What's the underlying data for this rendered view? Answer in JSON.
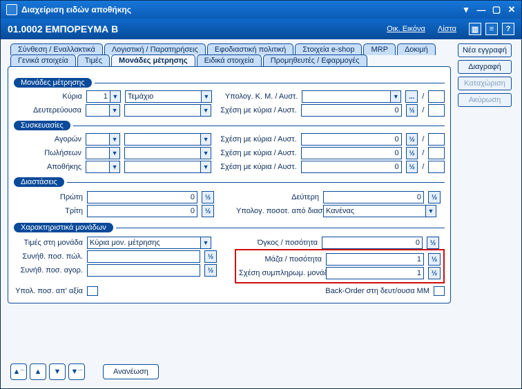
{
  "window": {
    "title": "Διαχείριση ειδών αποθήκης"
  },
  "subheader": {
    "code_name": "01.0002 ΕΜΠΟΡΕΥΜΑ Β",
    "link_econ_image": "Οικ. Εικόνα",
    "link_list": "Λίστα"
  },
  "tabs_row1": {
    "t1": "Σύνθεση / Εναλλακτικά",
    "t2": "Λογιστική / Παρατηρήσεις",
    "t3": "Εφοδιαστική πολιτική",
    "t4": "Στοιχεία e-shop",
    "t5": "MRP",
    "t6": "Δοκιμή"
  },
  "tabs_row2": {
    "t1": "Γενικά στοιχεία",
    "t2": "Τιμές",
    "t3": "Μονάδες μέτρησης",
    "t4": "Ειδικά στοιχεία",
    "t5": "Προμηθευτές / Εφαρμογές"
  },
  "right_buttons": {
    "new": "Νέα εγγραφή",
    "delete": "Διαγραφή",
    "save": "Καταχώριση",
    "cancel": "Ακύρωση"
  },
  "groups": {
    "units": "Μονάδες μέτρησης",
    "packaging": "Συσκευασίες",
    "dimensions": "Διαστάσεις",
    "unit_chars": "Χαρακτηριστικά μονάδων"
  },
  "labels": {
    "main": "Κύρια",
    "secondary": "Δευτερεύουσα",
    "calc_km": "Υπολογ. Κ. Μ. / Αυστ.",
    "rel_main": "Σχέση με κύρια / Αυστ.",
    "purchases": "Αγορών",
    "sales": "Πωλήσεων",
    "warehouse": "Αποθήκης",
    "first": "Πρώτη",
    "second": "Δεύτερη",
    "third": "Τρίτη",
    "calc_qty_dims": "Υπολογ. ποσοτ. από διαστάσεις",
    "values_at_unit": "Τιμές στη μονάδα",
    "usual_qty_sales": "Συνήθ. ποσ. πώλ.",
    "usual_qty_purch": "Συνήθ. ποσ. αγορ.",
    "volume_per_qty": "Όγκος / ποσότητα",
    "mass_per_qty": "Μάζα / ποσότητα",
    "rel_supp_unit": "Σχέση συμπληρωμ. μονάδας με κύρια",
    "calc_from_value": "Υπολ. ποσ. απ' αξία",
    "back_order": "Back-Order στη δευτ/ουσα MM"
  },
  "values": {
    "main_code": "1",
    "main_unit": "Τεμάχιο",
    "secondary_code": "",
    "secondary_unit": "",
    "calc_km_unit": "",
    "rel_main_secondary": "0",
    "rel_main_purch": "0",
    "rel_main_sales": "0",
    "rel_main_wh": "0",
    "dim_first": "0",
    "dim_second": "0",
    "dim_third": "0",
    "calc_qty_dims": "Κανένας",
    "values_at_unit": "Κύρια μον. μέτρησης",
    "usual_qty_sales": "",
    "usual_qty_purch": "",
    "volume_per_qty": "0",
    "mass_per_qty": "1",
    "rel_supp_unit": "1"
  },
  "bottom": {
    "refresh": "Ανανέωση"
  },
  "glyphs": {
    "half": "½",
    "slash": "/",
    "dots": "...",
    "down": "▼",
    "up": "▲",
    "dbl_up": "▲",
    "dbl_down": "▼",
    "eq": "≡",
    "q": "?"
  }
}
